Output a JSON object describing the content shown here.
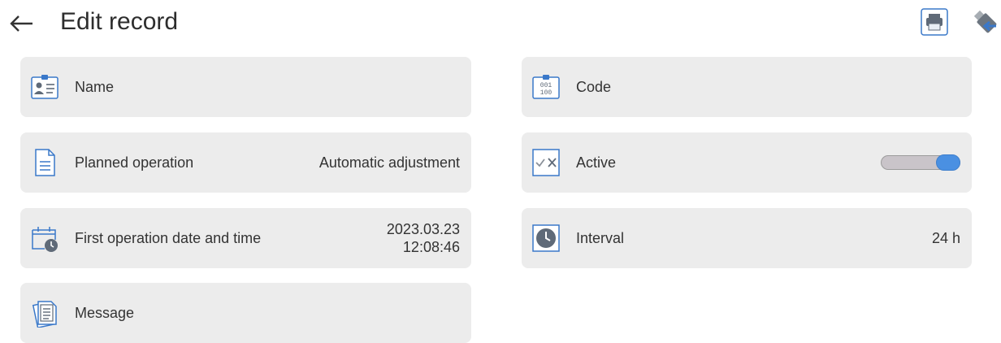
{
  "header": {
    "title": "Edit record"
  },
  "fields": {
    "name": {
      "label": "Name",
      "value": ""
    },
    "code": {
      "label": "Code",
      "value": ""
    },
    "planned_operation": {
      "label": "Planned operation",
      "value": "Automatic adjustment"
    },
    "active": {
      "label": "Active",
      "enabled": true
    },
    "first_operation": {
      "label": "First operation date and time",
      "date": "2023.03.23",
      "time": "12:08:46"
    },
    "interval": {
      "label": "Interval",
      "value": "24 h"
    },
    "message": {
      "label": "Message",
      "value": ""
    }
  },
  "icons": {
    "back": "back-arrow-icon",
    "print": "printer-icon",
    "export": "usb-export-icon",
    "name": "id-card-icon",
    "code": "code-icon",
    "planned": "document-icon",
    "active": "check-cross-icon",
    "first_date": "calendar-clock-icon",
    "interval": "clock-icon",
    "message": "message-icon"
  },
  "colors": {
    "accent": "#4a90e2",
    "card": "#ececec",
    "icon": "#3a78c9"
  }
}
